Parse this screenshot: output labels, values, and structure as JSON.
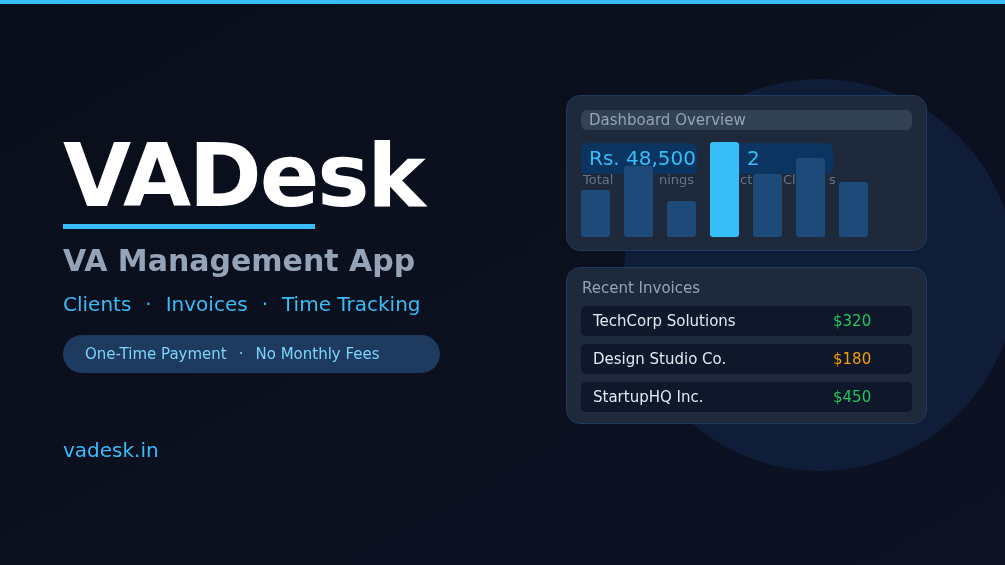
{
  "brand": {
    "title": "VADesk",
    "subtitle": "VA Management App",
    "features": [
      "Clients",
      "Invoices",
      "Time Tracking"
    ],
    "separator": "·",
    "pill": [
      "One-Time Payment",
      "No Monthly Fees"
    ],
    "website": "vadesk.in"
  },
  "dashboard": {
    "title": "Dashboard Overview",
    "stats": [
      {
        "value": "Rs. 48,500"
      },
      {
        "value": "2"
      }
    ],
    "label_fragments": [
      "Total",
      "nings",
      "ct",
      "Cl",
      "s"
    ],
    "bars": [
      {
        "highlighted": false
      },
      {
        "highlighted": false
      },
      {
        "highlighted": false
      },
      {
        "highlighted": true
      },
      {
        "highlighted": false
      },
      {
        "highlighted": false
      },
      {
        "highlighted": false
      }
    ]
  },
  "invoices": {
    "title": "Recent Invoices",
    "rows": [
      {
        "client": "TechCorp Solutions",
        "amount": "$320",
        "color": "#22c55e"
      },
      {
        "client": "Design Studio Co.",
        "amount": "$180",
        "color": "#f59e0b"
      },
      {
        "client": "StartupHQ Inc.",
        "amount": "$450",
        "color": "#22c55e"
      }
    ]
  }
}
